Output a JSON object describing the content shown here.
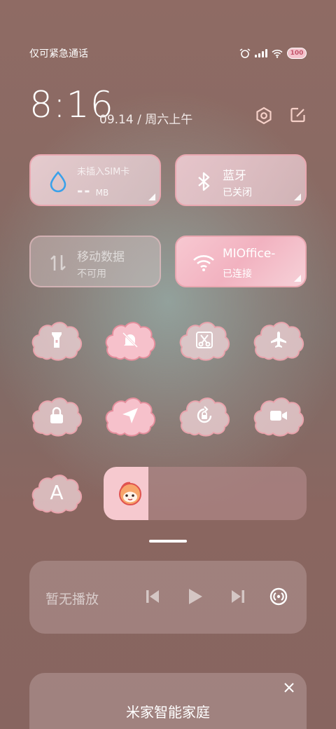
{
  "status": {
    "carrier": "仅可紧急通话",
    "battery": "100"
  },
  "header": {
    "time": "8:16",
    "date": "09.14 / 周六上午"
  },
  "tiles": {
    "data": {
      "title": "未插入SIM卡",
      "value": "--",
      "unit": "MB"
    },
    "bluetooth": {
      "title": "蓝牙",
      "status": "已关闭"
    },
    "mobile_data": {
      "title": "移动数据",
      "status": "不可用"
    },
    "wifi": {
      "title": "MIOffice-",
      "status": "已连接"
    }
  },
  "toggles": [
    {
      "name": "flashlight",
      "icon": "flashlight-icon"
    },
    {
      "name": "mute",
      "icon": "bell-off-icon"
    },
    {
      "name": "screenshot",
      "icon": "scissors-icon"
    },
    {
      "name": "airplane-mode",
      "icon": "airplane-icon"
    },
    {
      "name": "lock-screen",
      "icon": "lock-icon"
    },
    {
      "name": "location",
      "icon": "location-arrow-icon"
    },
    {
      "name": "rotation-lock",
      "icon": "rotation-lock-icon"
    },
    {
      "name": "screen-record",
      "icon": "video-camera-icon"
    }
  ],
  "auto_brightness": {
    "label": "A"
  },
  "brightness": {
    "level_percent": 22
  },
  "media": {
    "status": "暂无播放"
  },
  "smart_home": {
    "title": "米家智能家庭"
  },
  "colors": {
    "accent_pink": "#f2b2c0",
    "border_pink": "#e9a7b0",
    "drop_blue": "#3aa1ea"
  }
}
